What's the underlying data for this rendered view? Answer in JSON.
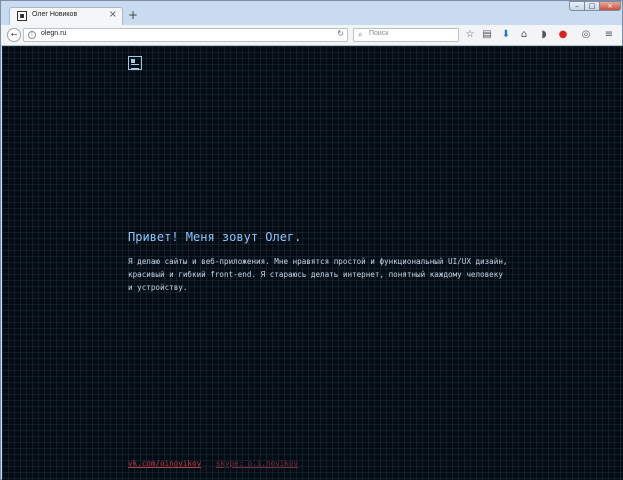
{
  "browser": {
    "tab_title": "Олег Новиков",
    "tab_close": "×",
    "new_tab": "+",
    "url": "olegn.ru",
    "search_placeholder": "Поиск"
  },
  "page": {
    "headline": "Привет! Меня зовут Олег.",
    "intro": "Я делаю сайты и веб-приложения. Мне нравятся простой и функциональный UI/UX дизайн, красивый и гибкий front-end. Я стараюсь делать интернет, понятный каждому человеку и устройству.",
    "links": {
      "vk": "vk.com/oinovikov",
      "skype": "skype: o.i.novikov"
    }
  },
  "colors": {
    "background": "#040b13",
    "headline": "#8ec5ff",
    "text": "#c5d6e6",
    "link_primary": "#c0394a",
    "link_secondary": "#7a2e3e"
  }
}
